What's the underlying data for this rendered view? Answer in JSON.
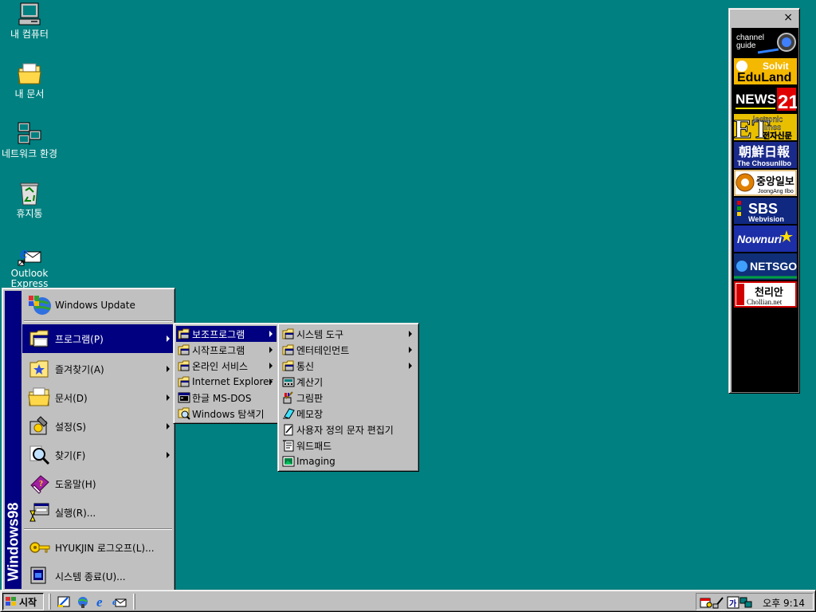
{
  "desktop": {
    "icons": [
      {
        "label": "내 컴퓨터",
        "icon": "my-computer-icon"
      },
      {
        "label": "내 문서",
        "icon": "my-documents-icon"
      },
      {
        "label": "네트워크 환경",
        "icon": "network-neighborhood-icon"
      },
      {
        "label": "휴지통",
        "icon": "recycle-bin-icon"
      },
      {
        "label": "Outlook Express",
        "icon": "outlook-express-icon"
      }
    ]
  },
  "channel_bar": {
    "close_glyph": "×",
    "channels": [
      {
        "label": "channel guide",
        "icon": "channel-guide-icon"
      },
      {
        "label": "Solvit EduLand",
        "icon": "eduland-icon"
      },
      {
        "label": "NEWS21",
        "icon": "news21-icon"
      },
      {
        "label": "Electronic Times 전자신문",
        "icon": "electronic-times-icon"
      },
      {
        "label": "朝鮮日報 The ChosunIlbo",
        "icon": "chosun-ilbo-icon"
      },
      {
        "label": "중앙일보 JoongAng Ilbo",
        "icon": "joongang-ilbo-icon"
      },
      {
        "label": "SBS Webvision",
        "icon": "sbs-icon"
      },
      {
        "label": "Nownuri",
        "icon": "nownuri-icon"
      },
      {
        "label": "NETSGO",
        "icon": "netsgo-icon"
      },
      {
        "label": "천리안 Chollian.net",
        "icon": "chollian-icon"
      }
    ]
  },
  "start_menu": {
    "sidebar_text": "Windows98",
    "items": [
      {
        "label": "Windows Update",
        "icon": "windows-update-icon",
        "submenu": false
      },
      {
        "label": "프로그램(P)",
        "icon": "programs-icon",
        "submenu": true,
        "selected": true
      },
      {
        "label": "즐겨찾기(A)",
        "icon": "favorites-icon",
        "submenu": true
      },
      {
        "label": "문서(D)",
        "icon": "documents-icon",
        "submenu": true
      },
      {
        "label": "설정(S)",
        "icon": "settings-icon",
        "submenu": true
      },
      {
        "label": "찾기(F)",
        "icon": "find-icon",
        "submenu": true
      },
      {
        "label": "도움말(H)",
        "icon": "help-icon",
        "submenu": false
      },
      {
        "label": "실행(R)...",
        "icon": "run-icon",
        "submenu": false
      },
      {
        "label": "HYUKJIN 로그오프(L)...",
        "icon": "logoff-icon",
        "submenu": false
      },
      {
        "label": "시스템 종료(U)...",
        "icon": "shutdown-icon",
        "submenu": false
      }
    ]
  },
  "programs_menu": {
    "items": [
      {
        "label": "보조프로그램",
        "icon": "folder-icon",
        "submenu": true,
        "selected": true
      },
      {
        "label": "시작프로그램",
        "icon": "folder-icon",
        "submenu": true
      },
      {
        "label": "온라인 서비스",
        "icon": "folder-icon",
        "submenu": true
      },
      {
        "label": "Internet Explorer",
        "icon": "folder-icon",
        "submenu": true
      },
      {
        "label": "한글 MS-DOS",
        "icon": "ms-dos-icon",
        "submenu": false
      },
      {
        "label": "Windows 탐색기",
        "icon": "explorer-icon",
        "submenu": false
      }
    ]
  },
  "accessories_menu": {
    "items": [
      {
        "label": "시스템 도구",
        "icon": "folder-icon",
        "submenu": true
      },
      {
        "label": "엔터테인먼트",
        "icon": "folder-icon",
        "submenu": true
      },
      {
        "label": "통신",
        "icon": "folder-icon",
        "submenu": true
      },
      {
        "label": "계산기",
        "icon": "calculator-icon",
        "submenu": false
      },
      {
        "label": "그림판",
        "icon": "paint-icon",
        "submenu": false
      },
      {
        "label": "메모장",
        "icon": "notepad-icon",
        "submenu": false
      },
      {
        "label": "사용자 정의 문자 편집기",
        "icon": "character-editor-icon",
        "submenu": false
      },
      {
        "label": "워드패드",
        "icon": "wordpad-icon",
        "submenu": false
      },
      {
        "label": "Imaging",
        "icon": "imaging-icon",
        "submenu": false
      }
    ]
  },
  "taskbar": {
    "start_label": "시작",
    "quick_launch": [
      "show-desktop-icon",
      "internet-explorer-icon",
      "ie-browser-icon",
      "outlook-icon"
    ],
    "tray_icons": [
      "scheduler-icon",
      "pen-icon",
      "ime-icon",
      "network-icon"
    ],
    "clock": "오후 9:14"
  }
}
